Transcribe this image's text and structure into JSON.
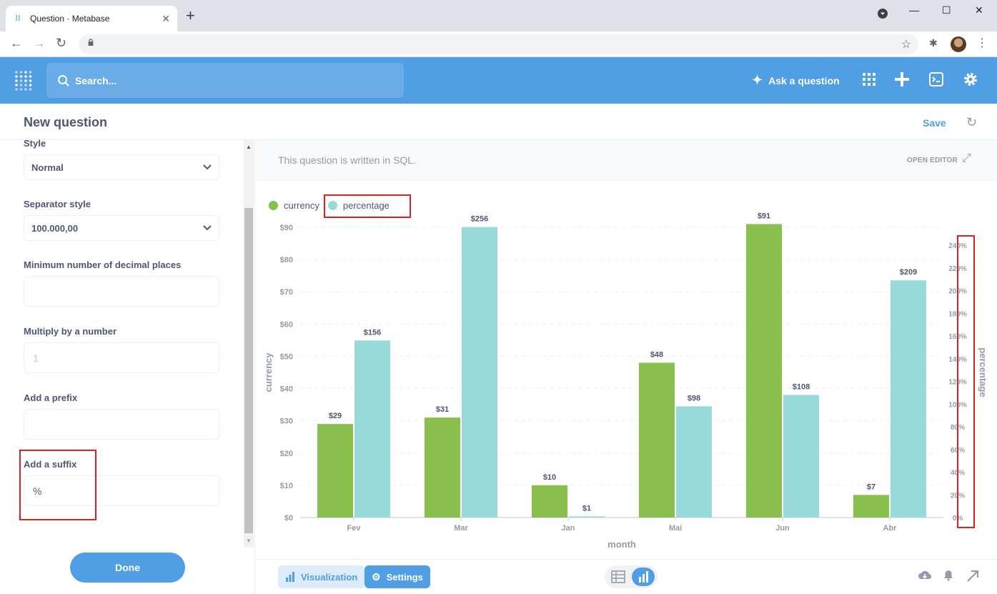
{
  "browser": {
    "tab_title": "Question · Metabase",
    "tab_close": "✕",
    "new_tab": "+"
  },
  "mb": {
    "search_placeholder": "Search...",
    "ask_question": "Ask a question"
  },
  "question": {
    "title": "New question",
    "save": "Save"
  },
  "sidebar": {
    "style_label": "Style",
    "style_value": "Normal",
    "separator_label": "Separator style",
    "separator_value": "100.000,00",
    "min_decimal_label": "Minimum number of decimal places",
    "min_decimal_value": "",
    "multiply_label": "Multiply by a number",
    "multiply_placeholder": "1",
    "prefix_label": "Add a prefix",
    "prefix_value": "",
    "suffix_label": "Add a suffix",
    "suffix_value": "%",
    "done": "Done"
  },
  "main": {
    "sql_note": "This question is written in SQL.",
    "open_editor": "OPEN EDITOR",
    "visualization": "Visualization",
    "settings": "Settings"
  },
  "colors": {
    "currency": "#88bf4d",
    "percentage": "#98d9d9",
    "brand": "#509ee3",
    "highlight": "#e02020"
  },
  "chart_data": {
    "type": "bar",
    "categories": [
      "Fev",
      "Mar",
      "Jan",
      "Mai",
      "Jun",
      "Abr"
    ],
    "series": [
      {
        "name": "currency",
        "values": [
          29,
          31,
          10,
          48,
          91,
          7
        ],
        "labels": [
          "$29",
          "$31",
          "$10",
          "$48",
          "$91",
          "$7"
        ],
        "axis": "left"
      },
      {
        "name": "percentage",
        "values": [
          156,
          256,
          1,
          98,
          108,
          209
        ],
        "labels": [
          "$156",
          "$256",
          "$1",
          "$98",
          "$108",
          "$209"
        ],
        "axis": "right"
      }
    ],
    "xlabel": "month",
    "ylabel": "currency",
    "y2label": "percentage",
    "ylim": [
      0,
      90
    ],
    "y2lim": [
      0,
      255
    ],
    "yticks": [
      "$0",
      "$10",
      "$20",
      "$30",
      "$40",
      "$50",
      "$60",
      "$70",
      "$80",
      "$90"
    ],
    "y2ticks": [
      "0%",
      "20%",
      "40%",
      "60%",
      "80%",
      "100%",
      "120%",
      "140%",
      "160%",
      "180%",
      "200%",
      "220%",
      "240%"
    ],
    "grid": true,
    "legend": "top-left"
  }
}
